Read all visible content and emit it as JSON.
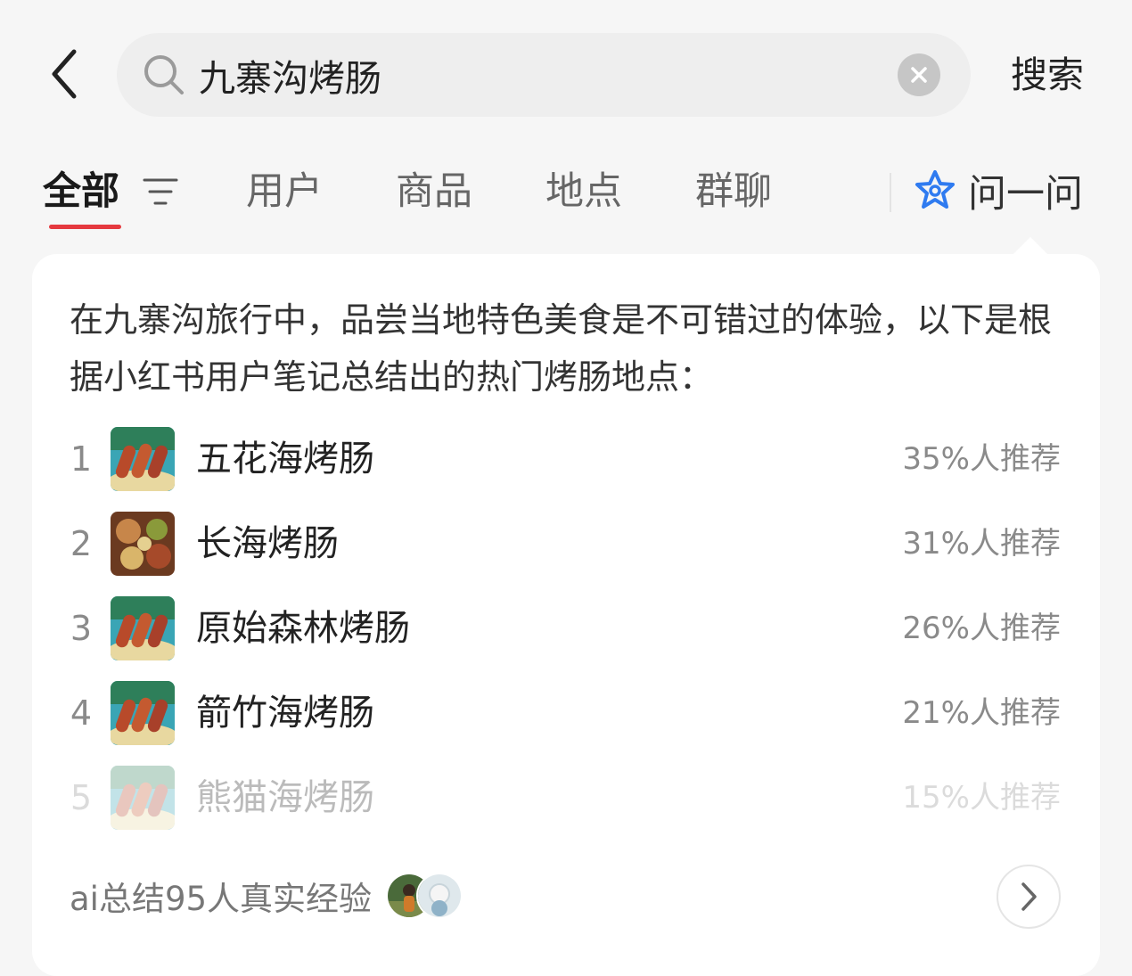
{
  "search": {
    "query": "九寨沟烤肠",
    "submit_label": "搜索"
  },
  "tabs": [
    {
      "label": "全部",
      "active": true
    },
    {
      "label": "用户",
      "active": false
    },
    {
      "label": "商品",
      "active": false
    },
    {
      "label": "地点",
      "active": false
    },
    {
      "label": "群聊",
      "active": false
    }
  ],
  "ask_tab": {
    "label": "问一问",
    "icon": "ai-star-icon"
  },
  "summary": {
    "intro": "在九寨沟旅行中，品尝当地特色美食是不可错过的体验，以下是根据小红书用户笔记总结出的热门烤肠地点：",
    "items": [
      {
        "rank": "1",
        "name": "五花海烤肠",
        "percent": "35%人推荐",
        "thumb": "sausage-lake-photo"
      },
      {
        "rank": "2",
        "name": "长海烤肠",
        "percent": "31%人推荐",
        "thumb": "food-spread-photo"
      },
      {
        "rank": "3",
        "name": "原始森林烤肠",
        "percent": "26%人推荐",
        "thumb": "sausage-lake-photo"
      },
      {
        "rank": "4",
        "name": "箭竹海烤肠",
        "percent": "21%人推荐",
        "thumb": "sausage-lake-photo"
      },
      {
        "rank": "5",
        "name": "熊猫海烤肠",
        "percent": "15%人推荐",
        "thumb": "sausage-lake-photo"
      }
    ],
    "footer_text": "ai总结95人真实经验"
  },
  "colors": {
    "accent": "#e5393f",
    "ask_icon": "#2f7bf0",
    "background": "#f6f6f6",
    "card": "#ffffff"
  }
}
